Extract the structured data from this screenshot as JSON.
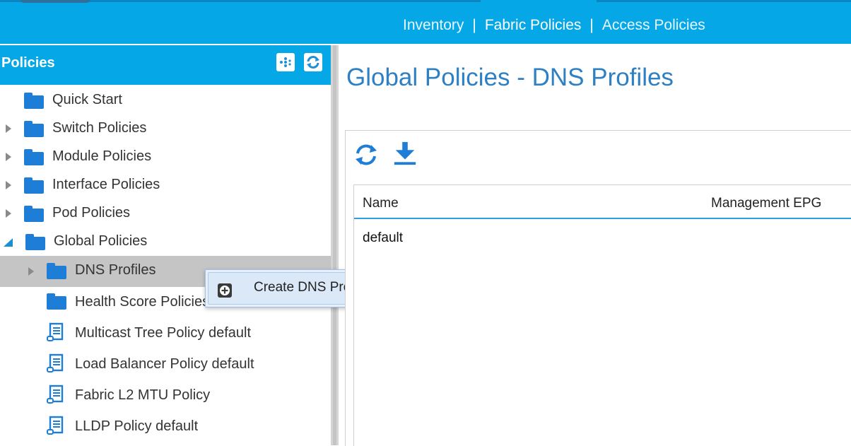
{
  "topnav": {
    "items": [
      "Inventory",
      "Fabric Policies",
      "Access Policies"
    ],
    "separator": "|"
  },
  "left_panel": {
    "title": "Policies",
    "tree": [
      {
        "label": "Quick Start",
        "icon": "folder-icon",
        "expander": "none"
      },
      {
        "label": "Switch Policies",
        "icon": "folder-icon",
        "expander": "collapsed"
      },
      {
        "label": "Module Policies",
        "icon": "folder-icon",
        "expander": "collapsed"
      },
      {
        "label": "Interface Policies",
        "icon": "folder-icon",
        "expander": "collapsed"
      },
      {
        "label": "Pod Policies",
        "icon": "folder-icon",
        "expander": "collapsed"
      },
      {
        "label": "Global Policies",
        "icon": "folder-icon",
        "expander": "expanded"
      },
      {
        "label": "DNS Profiles",
        "icon": "folder-icon",
        "expander": "collapsed",
        "selected": true
      },
      {
        "label": "Health Score Policies",
        "icon": "folder-icon",
        "expander": "none"
      },
      {
        "label": "Multicast Tree Policy default",
        "icon": "policy-scroll-icon",
        "expander": "none"
      },
      {
        "label": "Load Balancer Policy default",
        "icon": "policy-scroll-icon",
        "expander": "none"
      },
      {
        "label": "Fabric L2 MTU Policy",
        "icon": "policy-scroll-icon",
        "expander": "none"
      },
      {
        "label": "LLDP Policy default",
        "icon": "policy-scroll-icon",
        "expander": "none"
      }
    ]
  },
  "context_menu": {
    "item_label": "Create DNS Profile",
    "icon": "plus-icon"
  },
  "main": {
    "title": "Global Policies - DNS Profiles",
    "table": {
      "columns": [
        "Name",
        "Management EPG"
      ],
      "rows": [
        [
          "default",
          ""
        ]
      ]
    }
  },
  "colors": {
    "accent": "#05a7e6",
    "title_blue": "#2d80c4",
    "folder_blue": "#1e7ed7",
    "selection_gray": "#c5c5c5"
  }
}
